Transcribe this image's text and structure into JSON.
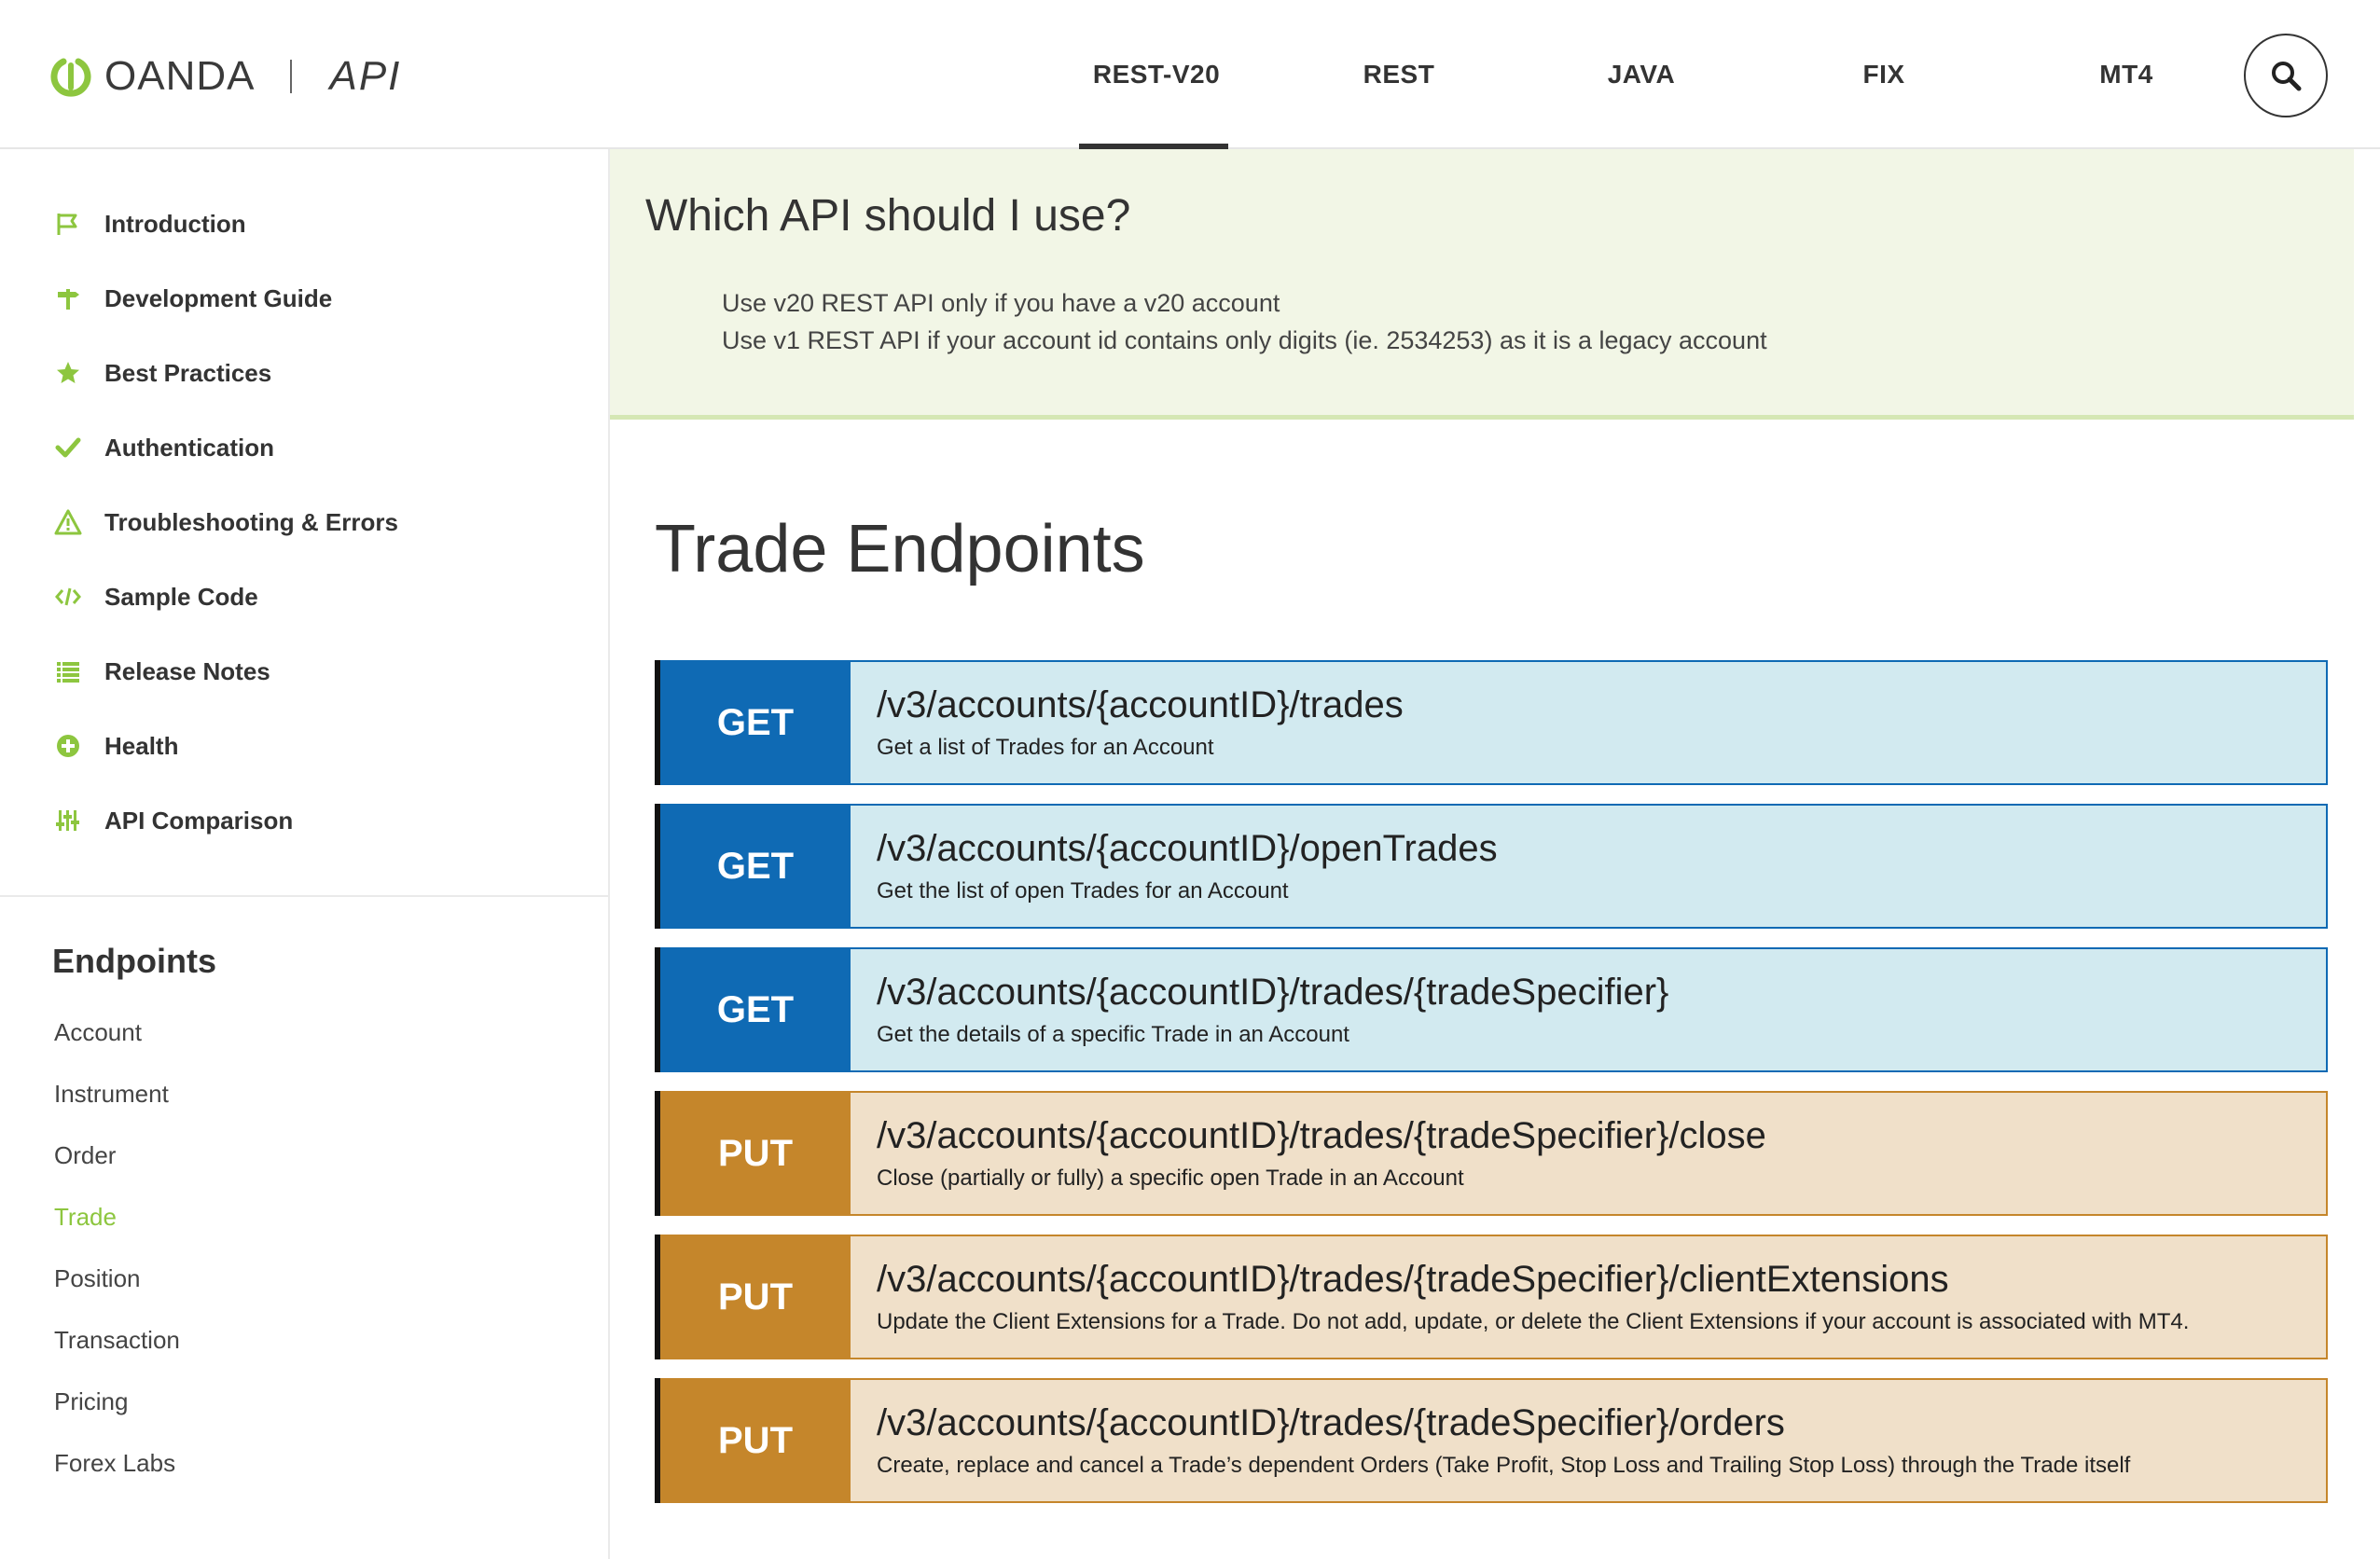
{
  "header": {
    "logo_word": "OANDA",
    "logo_api": "API",
    "nav": [
      {
        "label": "REST-V20",
        "active": true
      },
      {
        "label": "REST",
        "active": false
      },
      {
        "label": "JAVA",
        "active": false
      },
      {
        "label": "FIX",
        "active": false
      },
      {
        "label": "MT4",
        "active": false
      }
    ],
    "search_icon": "search-icon"
  },
  "sidebar": {
    "items": [
      {
        "label": "Introduction",
        "icon": "flag-icon"
      },
      {
        "label": "Development Guide",
        "icon": "signpost-icon"
      },
      {
        "label": "Best Practices",
        "icon": "star-icon"
      },
      {
        "label": "Authentication",
        "icon": "check-icon"
      },
      {
        "label": "Troubleshooting & Errors",
        "icon": "warning-icon"
      },
      {
        "label": "Sample Code",
        "icon": "code-icon"
      },
      {
        "label": "Release Notes",
        "icon": "list-icon"
      },
      {
        "label": "Health",
        "icon": "plus-circle-icon"
      },
      {
        "label": "API Comparison",
        "icon": "sliders-icon"
      }
    ],
    "endpoints_title": "Endpoints",
    "endpoints": [
      {
        "label": "Account",
        "active": false
      },
      {
        "label": "Instrument",
        "active": false
      },
      {
        "label": "Order",
        "active": false
      },
      {
        "label": "Trade",
        "active": true
      },
      {
        "label": "Position",
        "active": false
      },
      {
        "label": "Transaction",
        "active": false
      },
      {
        "label": "Pricing",
        "active": false
      },
      {
        "label": "Forex Labs",
        "active": false
      }
    ]
  },
  "notice": {
    "title": "Which API should I use?",
    "line1": "Use v20 REST API only if you have a v20 account",
    "line2": "Use v1 REST API if your account id contains only digits (ie. 2534253) as it is a legacy account"
  },
  "main": {
    "title": "Trade Endpoints",
    "endpoints": [
      {
        "method": "GET",
        "path": "/v3/accounts/{accountID}/trades",
        "desc": "Get a list of Trades for an Account"
      },
      {
        "method": "GET",
        "path": "/v3/accounts/{accountID}/openTrades",
        "desc": "Get the list of open Trades for an Account"
      },
      {
        "method": "GET",
        "path": "/v3/accounts/{accountID}/trades/{tradeSpecifier}",
        "desc": "Get the details of a specific Trade in an Account"
      },
      {
        "method": "PUT",
        "path": "/v3/accounts/{accountID}/trades/{tradeSpecifier}/close",
        "desc": "Close (partially or fully) a specific open Trade in an Account"
      },
      {
        "method": "PUT",
        "path": "/v3/accounts/{accountID}/trades/{tradeSpecifier}/clientExtensions",
        "desc": "Update the Client Extensions for a Trade. Do not add, update, or delete the Client Extensions if your account is associated with MT4."
      },
      {
        "method": "PUT",
        "path": "/v3/accounts/{accountID}/trades/{tradeSpecifier}/orders",
        "desc": "Create, replace and cancel a Trade’s dependent Orders (Take Profit, Stop Loss and Trailing Stop Loss) through the Trade itself"
      }
    ]
  },
  "colors": {
    "accent_green": "#8dc63f",
    "get_blue": "#0f6ab4",
    "get_bg": "#d2eaf0",
    "put_orange": "#c5862b",
    "put_bg": "#f0e0c9"
  }
}
